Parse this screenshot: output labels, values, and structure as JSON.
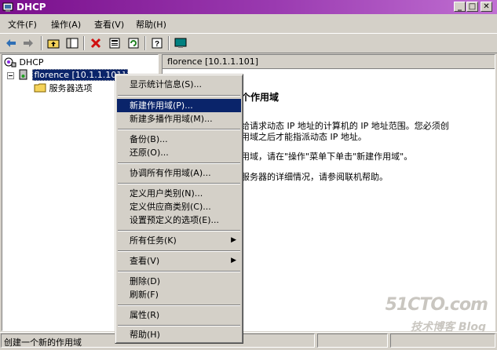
{
  "window": {
    "title": "DHCP",
    "min": "_",
    "max": "□",
    "close": "✕"
  },
  "menubar": [
    {
      "label": "文件(F)"
    },
    {
      "label": "操作(A)"
    },
    {
      "label": "查看(V)"
    },
    {
      "label": "帮助(H)"
    }
  ],
  "tree": {
    "root": "DHCP",
    "server": "florence [10.1.1.101]",
    "child": "服务器选项"
  },
  "rightpane": {
    "header": "florence [10.1.1.101]",
    "heading": "个作用域",
    "line1": "给请求动态 IP 地址的计算机的 IP 地址范围。您必须创",
    "line2": "用域之后才能指派动态 IP 地址。",
    "line3": "用域，请在\"操作\"菜单下单击\"新建作用域\"。",
    "line4": "服务器的详细情况，请参阅联机帮助。"
  },
  "context_menu": {
    "items": [
      {
        "label": "显示统计信息(S)..."
      },
      {
        "label": "新建作用域(P)...",
        "selected": true
      },
      {
        "label": "新建多播作用域(M)..."
      },
      {
        "label": "备份(B)..."
      },
      {
        "label": "还原(O)..."
      },
      {
        "label": "协调所有作用域(A)..."
      },
      {
        "label": "定义用户类别(N)..."
      },
      {
        "label": "定义供应商类别(C)..."
      },
      {
        "label": "设置预定义的选项(E)..."
      },
      {
        "label": "所有任务(K)",
        "submenu": true
      },
      {
        "label": "查看(V)",
        "submenu": true
      },
      {
        "label": "删除(D)"
      },
      {
        "label": "刷新(F)"
      },
      {
        "label": "属性(R)"
      },
      {
        "label": "帮助(H)"
      }
    ]
  },
  "statusbar": {
    "text": "创建一个新的作用域"
  },
  "watermark": {
    "line1": "51CTO.com",
    "line2": "技术博客  Blog"
  }
}
